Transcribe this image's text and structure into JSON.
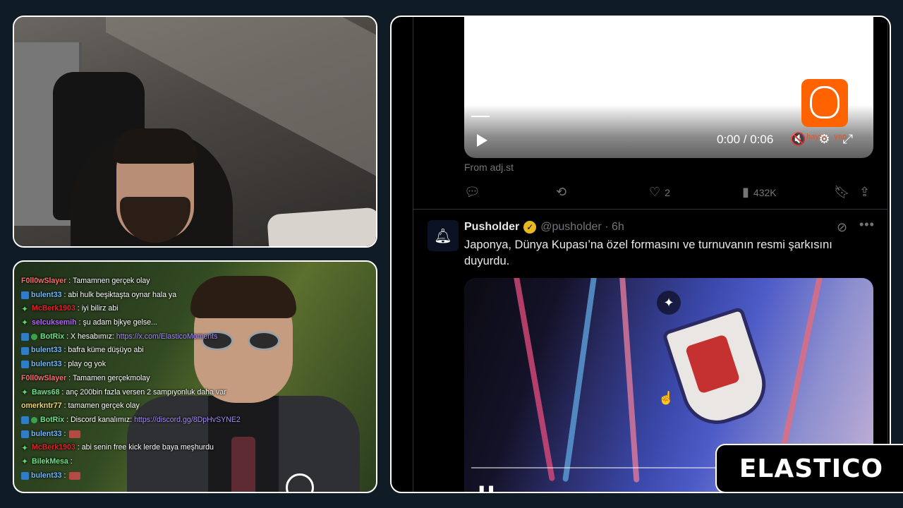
{
  "chat": {
    "messages": [
      {
        "user": "F0ll0wSlayer",
        "user_color": "#ff6b6b",
        "badge": "none",
        "text": "Tamamnen gerçek olay"
      },
      {
        "user": "bulent33",
        "user_color": "#6fb6ff",
        "badge": "prime",
        "text": "abi hulk beşiktaşta oynar hala ya"
      },
      {
        "user": "McBerk1903",
        "user_color": "#e0222a",
        "badge": "star",
        "text": "iyi bilirz abi"
      },
      {
        "user": "selcuksemih",
        "user_color": "#b264ff",
        "badge": "star",
        "text": "şu adam bjkye gelse..."
      },
      {
        "user": "BotRix",
        "user_color": "#6fe38a",
        "badge": "prime-check",
        "text": "X hesabımız:",
        "link": "https://x.com/ElasticoMoments"
      },
      {
        "user": "bulent33",
        "user_color": "#6fb6ff",
        "badge": "prime",
        "text": "bafra küme düşüyo abi"
      },
      {
        "user": "bulent33",
        "user_color": "#6fb6ff",
        "badge": "prime",
        "text": "play og yok"
      },
      {
        "user": "F0ll0wSlayer",
        "user_color": "#ff6b6b",
        "badge": "none",
        "text": "Tamamen gerçekmolay"
      },
      {
        "user": "Baws68",
        "user_color": "#6fe38a",
        "badge": "star",
        "text": "anç 200bin fazla versen 2 sampıyonluk daha var"
      },
      {
        "user": "omerkntr77",
        "user_color": "#f3d36a",
        "badge": "none",
        "text": "tamamen gerçek olay"
      },
      {
        "user": "BotRix",
        "user_color": "#6fe38a",
        "badge": "prime-check",
        "text": "Discord kanalımız:",
        "link": "https://discord.gg/8DpHvSYNE2"
      },
      {
        "user": "bulent33",
        "user_color": "#6fb6ff",
        "badge": "prime",
        "text": "",
        "emote": true
      },
      {
        "user": "McBerk1903",
        "user_color": "#e0222a",
        "badge": "star",
        "text": "abi senin free kick lerde baya meşhurdu"
      },
      {
        "user": "BilekMesa",
        "user_color": "#6fe38a",
        "badge": "star",
        "text": ""
      },
      {
        "user": "bulent33",
        "user_color": "#6fb6ff",
        "badge": "prime",
        "text": "",
        "emote": true
      }
    ]
  },
  "tweet_prev": {
    "video_time": "0:00 / 0:06",
    "from": "From adj.st",
    "likes": "2",
    "views": "432K",
    "ad_text": "ım hayat... yap"
  },
  "tweet": {
    "name": "Pusholder",
    "handle": "@pusholder · 6h",
    "text": "Japonya, Dünya Kupası’na özel formasını ve turnuvanın resmi şarkısını duyurdu."
  },
  "logo": {
    "text": "ELASTICO"
  }
}
